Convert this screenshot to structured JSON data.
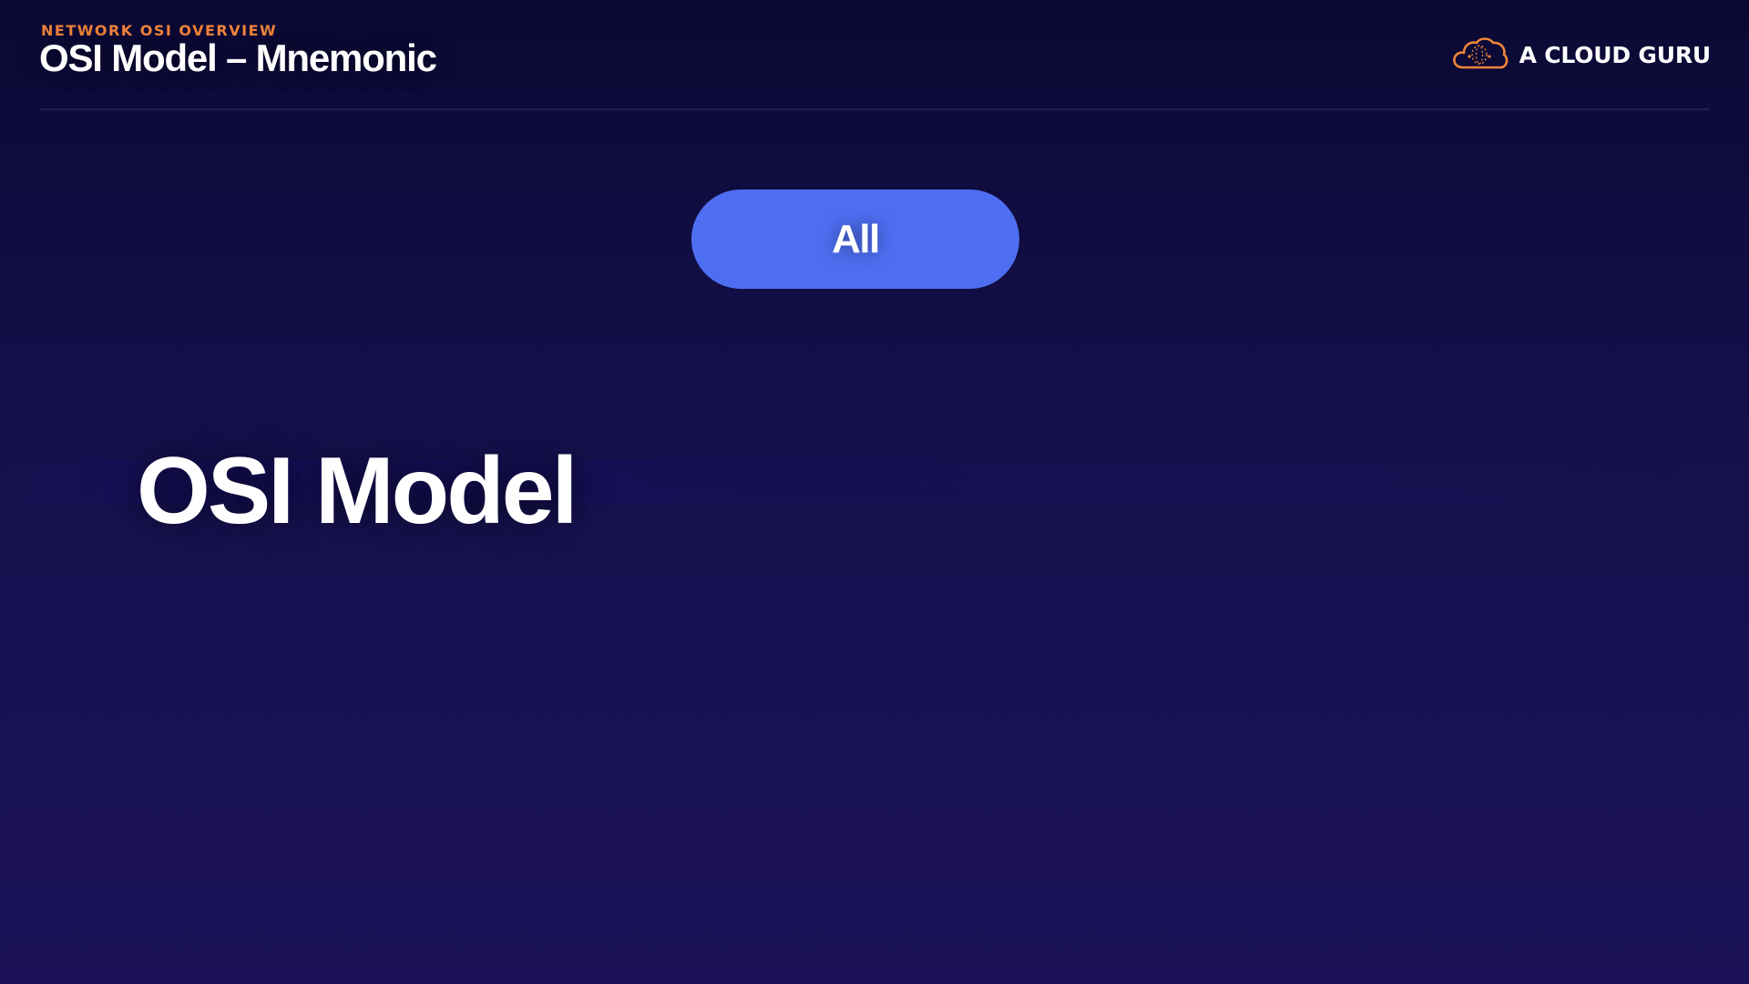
{
  "header": {
    "eyebrow": "NETWORK OSI OVERVIEW",
    "title": "OSI Model – Mnemonic"
  },
  "brand": {
    "name": "A CLOUD GURU",
    "logo_icon": "cloud-logo-icon",
    "accent_color": "#f0843a"
  },
  "pill": {
    "label": "All",
    "color": "#4e6ef2"
  },
  "main": {
    "heading": "OSI Model"
  },
  "colors": {
    "background_top": "#0b0933",
    "background_bottom": "#1b1257",
    "text": "#ffffff"
  }
}
